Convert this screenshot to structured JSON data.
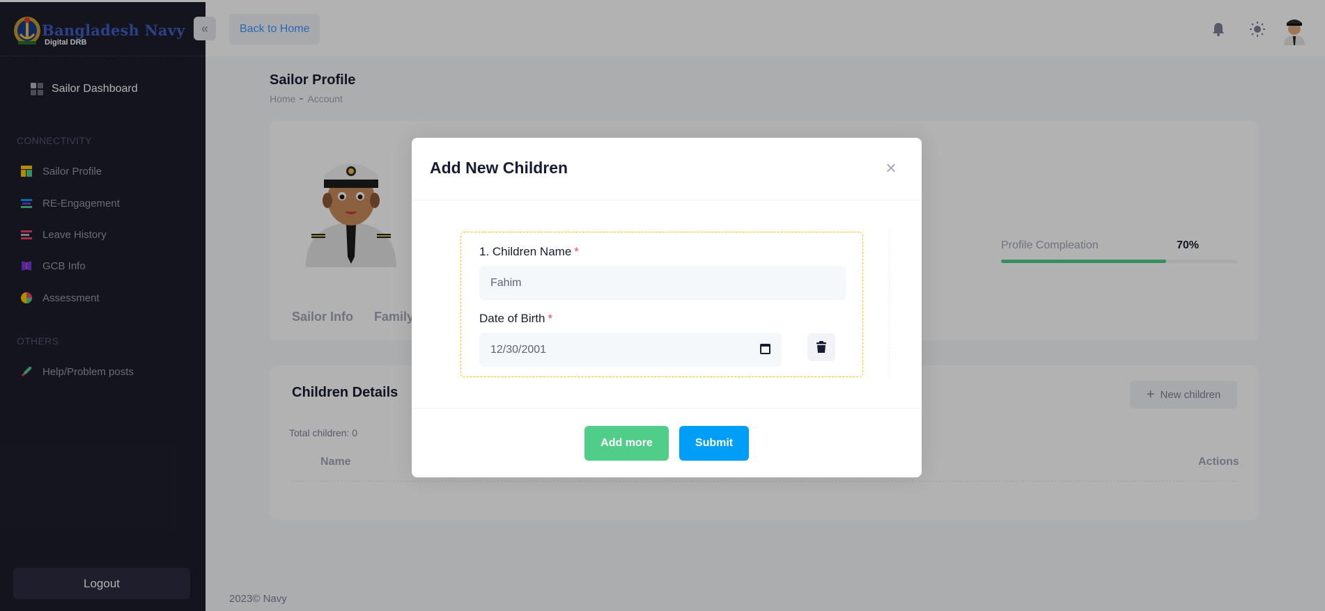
{
  "sidebar": {
    "brand": "Bangladesh Navy",
    "sub": "Digital DRB",
    "dashboard": "Sailor Dashboard",
    "section_connectivity": "CONNECTIVITY",
    "items": [
      {
        "label": "Sailor Profile",
        "icon": "profile-icon"
      },
      {
        "label": "RE-Engagement",
        "icon": "engagement-icon"
      },
      {
        "label": "Leave History",
        "icon": "history-icon"
      },
      {
        "label": "GCB Info",
        "icon": "book-icon"
      },
      {
        "label": "Assessment",
        "icon": "pie-chart-icon"
      }
    ],
    "section_others": "OTHERS",
    "help": "Help/Problem posts",
    "logout": "Logout"
  },
  "topbar": {
    "back_home": "Back to Home"
  },
  "page": {
    "title": "Sailor Profile",
    "breadcrumb": [
      "Home",
      "Account"
    ]
  },
  "profile": {
    "completion_label": "Profile Compleation",
    "completion_text": "70%",
    "completion_value": 0.7,
    "tabs": [
      "Sailor Info",
      "Family"
    ]
  },
  "children": {
    "title": "Children Details",
    "new_button": "New children",
    "total": "Total children: 0",
    "col_name": "Name",
    "col_actions": "Actions"
  },
  "footer": {
    "text": "2023© Navy"
  },
  "modal": {
    "title": "Add New Children",
    "name_label": "1. Children Name",
    "name_value": "Fahim",
    "dob_label": "Date of Birth",
    "dob_value": "12/30/2001",
    "required_mark": "*",
    "add_more": "Add more",
    "submit": "Submit"
  },
  "colors": {
    "sidebar": "#1e1e2d",
    "accent": "#009ef7",
    "success": "#50cd89",
    "required": "#f1416c"
  }
}
